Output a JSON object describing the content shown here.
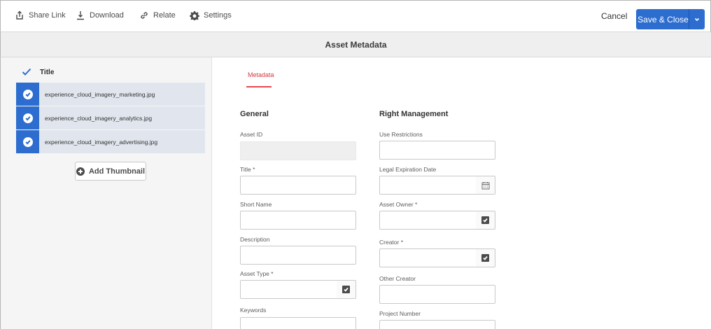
{
  "toolbar": {
    "share_link": "Share Link",
    "download": "Download",
    "relate": "Relate",
    "settings": "Settings",
    "cancel": "Cancel",
    "save_close": "Save & Close"
  },
  "title": "Asset Metadata",
  "asset_list": {
    "header": "Title",
    "items": [
      {
        "name": "experience_cloud_imagery_marketing.jpg"
      },
      {
        "name": "experience_cloud_imagery_analytics.jpg"
      },
      {
        "name": "experience_cloud_imagery_advertising.jpg"
      }
    ],
    "add_thumbnail": "Add Thumbnail"
  },
  "tabs": {
    "metadata": "Metadata"
  },
  "general": {
    "title": "General",
    "asset_id": "Asset ID",
    "title_field": "Title *",
    "short_name": "Short Name",
    "description": "Description",
    "asset_type": "Asset Type *",
    "keywords": "Keywords"
  },
  "rights": {
    "title": "Right Management",
    "use_restrictions": "Use Restrictions",
    "legal_expiration": "Legal Expiration Date",
    "asset_owner": "Asset Owner *",
    "creator": "Creator *",
    "other_creator": "Other Creator",
    "project_number": "Project Number"
  },
  "colors": {
    "accent": "#2d6dcf",
    "tab_active": "#e34850"
  }
}
